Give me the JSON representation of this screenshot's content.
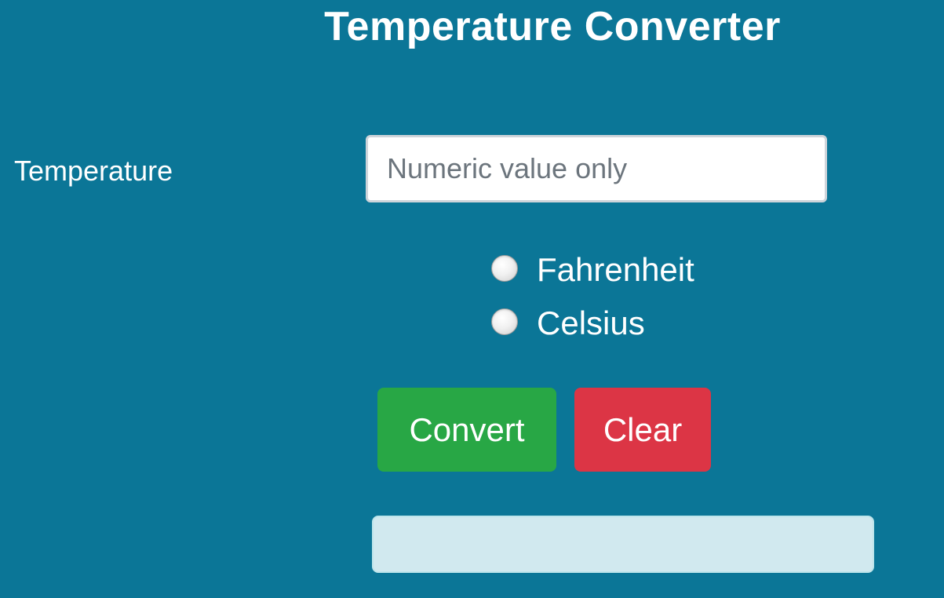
{
  "header": {
    "title": "Temperature Converter"
  },
  "form": {
    "temperature_label": "Temperature",
    "temperature_input": {
      "value": "",
      "placeholder": "Numeric value only"
    },
    "units": [
      {
        "label": "Fahrenheit",
        "checked": false
      },
      {
        "label": "Celsius",
        "checked": false
      }
    ],
    "convert_label": "Convert",
    "clear_label": "Clear",
    "result_text": ""
  },
  "colors": {
    "background": "#0b7697",
    "convert_button": "#28a745",
    "clear_button": "#dc3545",
    "result_box": "#d1e9ef"
  }
}
